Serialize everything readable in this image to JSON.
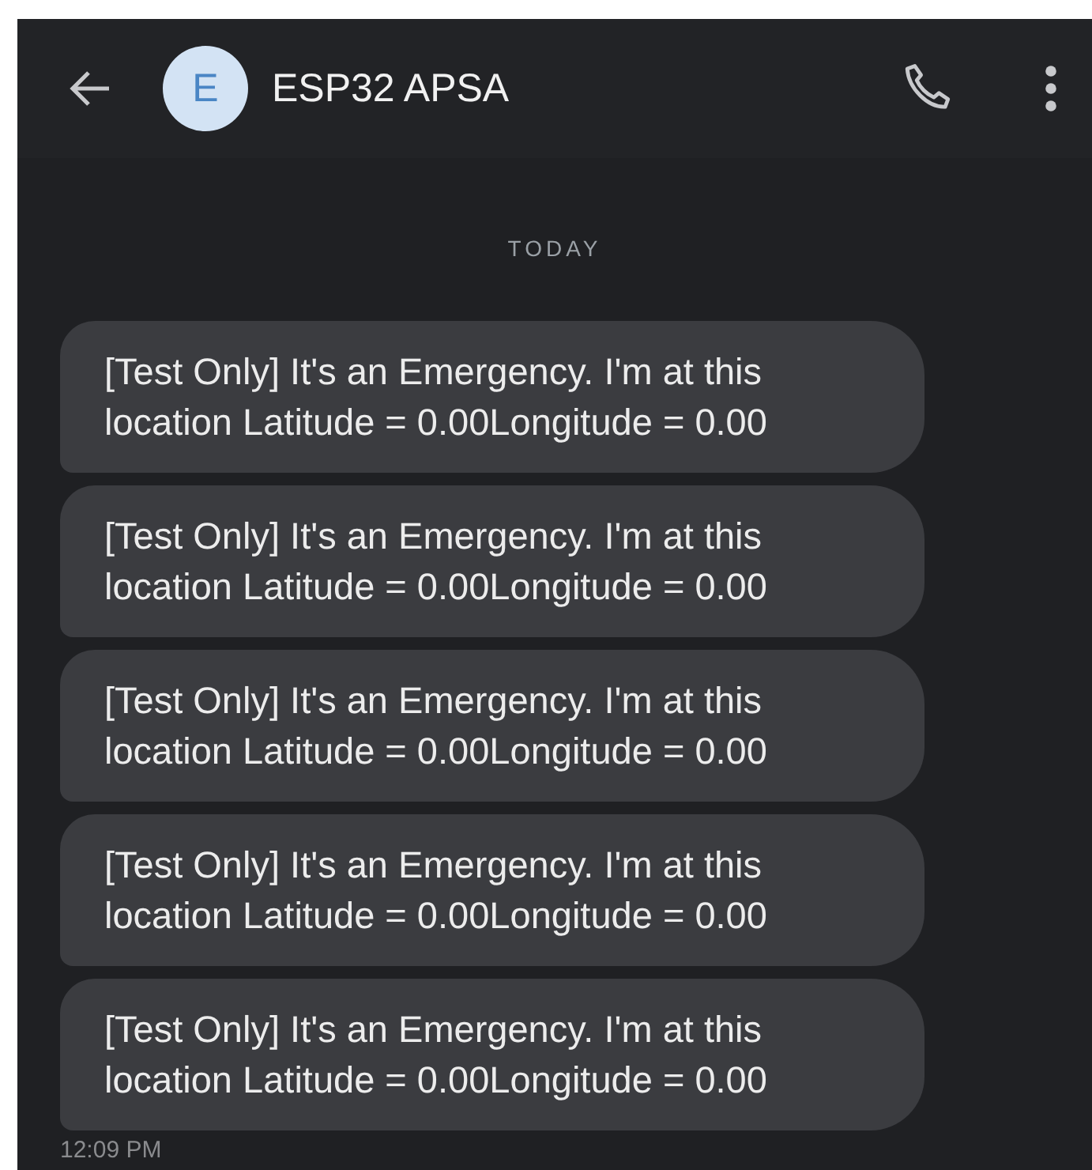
{
  "header": {
    "avatar_letter": "E",
    "title": "ESP32 APSA"
  },
  "date_divider": "TODAY",
  "messages": [
    {
      "text": "[Test Only] It's an Emergency. I'm at this location Latitude = 0.00Longitude = 0.00"
    },
    {
      "text": "[Test Only] It's an Emergency. I'm at this location Latitude = 0.00Longitude = 0.00"
    },
    {
      "text": "[Test Only] It's an Emergency. I'm at this location Latitude = 0.00Longitude = 0.00"
    },
    {
      "text": "[Test Only] It's an Emergency. I'm at this location Latitude = 0.00Longitude = 0.00"
    },
    {
      "text": "[Test Only] It's an Emergency. I'm at this location Latitude = 0.00Longitude = 0.00"
    }
  ],
  "timestamp": "12:09 PM"
}
